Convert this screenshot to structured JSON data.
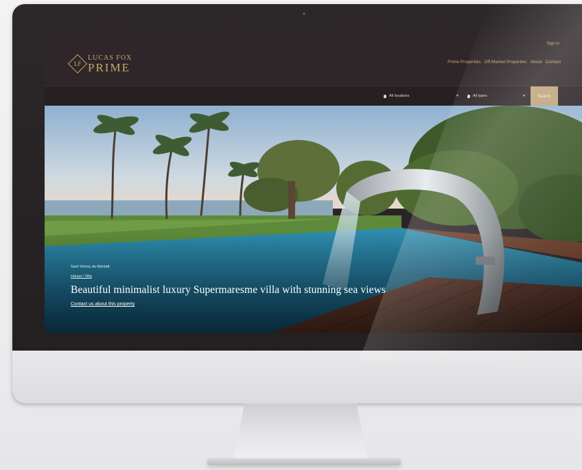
{
  "site": {
    "logo_top": "LUCAS FOX",
    "logo_bottom": "PRIME",
    "logo_monogram": "LF",
    "signin": "Sign in",
    "nav": [
      "Prime Properties",
      "Off-Market Properties",
      "About",
      "Contact"
    ]
  },
  "search": {
    "location_value": "All locations",
    "type_value": "All types",
    "button_label": "Search"
  },
  "hero": {
    "location": "Sant Vicenç de Montalt",
    "category": "House / Villa",
    "title": "Beautiful minimalist luxury Supermaresme villa with stunning sea views",
    "link": "Contact us about this property"
  },
  "colors": {
    "gold": "#c9a96a",
    "header_bg": "#2e2629",
    "search_button": "#bda176"
  }
}
